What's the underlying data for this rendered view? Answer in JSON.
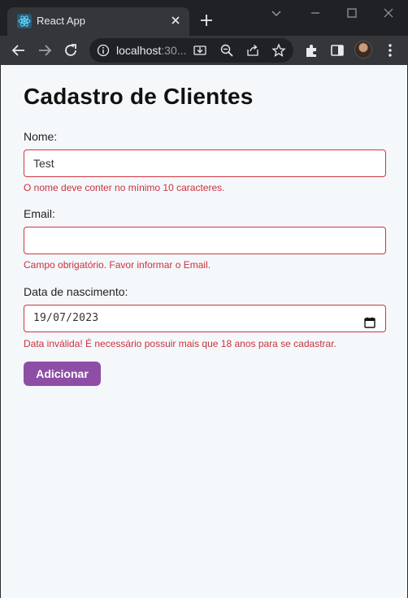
{
  "browser": {
    "tab_title": "React App",
    "url_host": "localhost",
    "url_rest": ":30...",
    "icons": [
      "react-favicon",
      "close-icon",
      "plus-icon",
      "chevron-down-icon",
      "minimize-icon",
      "maximize-icon",
      "close-window-icon",
      "back-arrow-icon",
      "forward-arrow-icon",
      "reload-icon",
      "info-icon",
      "install-icon",
      "zoom-icon",
      "share-icon",
      "star-icon",
      "extensions-icon",
      "sidebar-icon",
      "menu-icon"
    ]
  },
  "page": {
    "title": "Cadastro de Clientes",
    "fields": {
      "nome": {
        "label": "Nome:",
        "value": "Test",
        "error": "O nome deve conter no mínimo 10 caracteres."
      },
      "email": {
        "label": "Email:",
        "value": "",
        "error": "Campo obrigatório. Favor informar o Email."
      },
      "nascimento": {
        "label": "Data de nascimento:",
        "value": "19/07/2023",
        "error": "Data inválida! É necessário possuir mais que 18 anos para se cadastrar."
      }
    },
    "submit_label": "Adicionar"
  },
  "colors": {
    "error": "#c8323d",
    "button": "#8e4ea6",
    "page_bg": "#f5f8fb"
  }
}
